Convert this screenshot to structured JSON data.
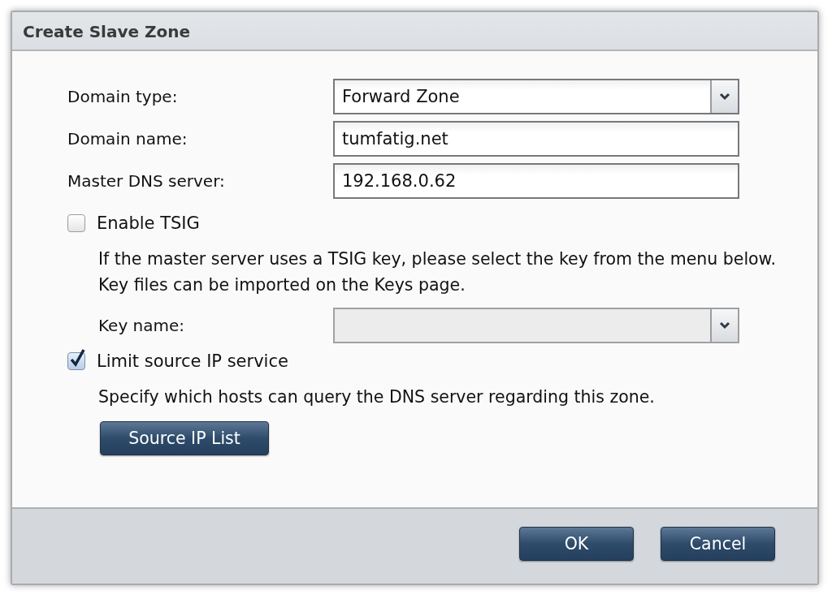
{
  "dialog": {
    "title": "Create Slave Zone"
  },
  "fields": [
    {
      "kind": "select",
      "label": "Domain type:",
      "value": "Forward Zone",
      "disabled": false
    },
    {
      "kind": "text",
      "label": "Domain name:",
      "value": "tumfatig.net",
      "disabled": false
    },
    {
      "kind": "text",
      "label": "Master DNS server:",
      "value": "192.168.0.62",
      "disabled": false
    }
  ],
  "options": [
    {
      "label": "Enable TSIG",
      "checked": false,
      "description": "If the master server uses a TSIG key, please select the key from the menu below. Key files can be imported on the Keys page.",
      "field": {
        "kind": "select",
        "label": "Key name:",
        "disabled": true
      }
    },
    {
      "label": "Limit source IP service",
      "checked": true,
      "description": "Specify which hosts can query the DNS server regarding this zone.",
      "button": "Source IP List"
    }
  ],
  "buttons": [
    "OK",
    "Cancel"
  ]
}
